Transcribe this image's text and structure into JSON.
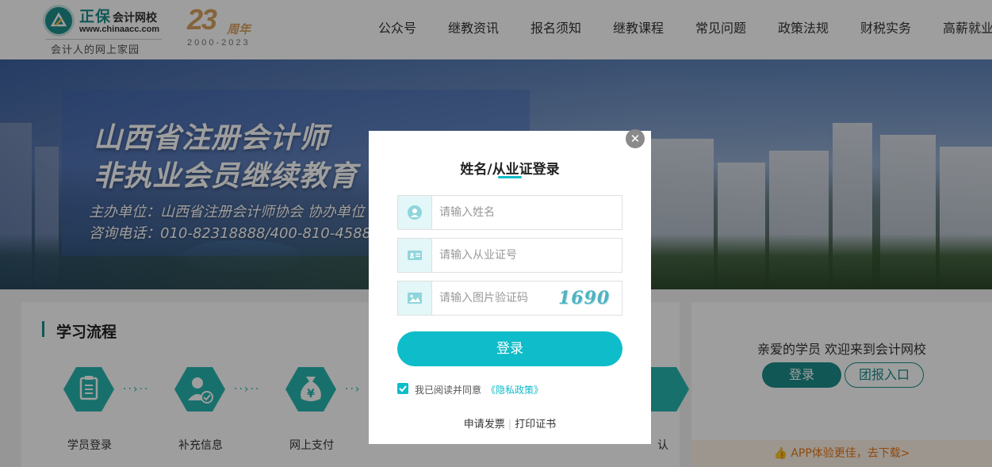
{
  "header": {
    "logo_brand": "正保",
    "logo_brand_sub": "会计网校",
    "logo_url": "www.chinaacc.com",
    "logo_slogan": "会计人的网上家园",
    "anniversary_number": "23",
    "anniversary_suffix": "周年",
    "anniversary_years": "2000-2023",
    "nav": [
      "公众号",
      "继教资讯",
      "报名须知",
      "继教课程",
      "常见问题",
      "政策法规",
      "财税实务",
      "高薪就业"
    ]
  },
  "banner": {
    "title_line1": "山西省注册会计师",
    "title_line2": "非执业会员继续教育",
    "organizer": "主办单位：山西省注册会计师协会   协办单位",
    "phone": "咨询电话：010-82318888/400-810-4588"
  },
  "study_process": {
    "title": "学习流程",
    "steps": [
      {
        "label": "学员登录",
        "icon": "clipboard-icon"
      },
      {
        "label": "补充信息",
        "icon": "user-check-icon"
      },
      {
        "label": "网上支付",
        "icon": "money-bag-icon"
      }
    ],
    "partial_label": "认"
  },
  "side_panel": {
    "welcome": "亲爱的学员 欢迎来到会计网校",
    "login_label": "登录",
    "group_label": "团报入口",
    "app_promo": "APP体验更佳，去下载>"
  },
  "modal": {
    "title": "姓名/从业证登录",
    "name_placeholder": "请输入姓名",
    "cert_placeholder": "请输入从业证号",
    "captcha_placeholder": "请输入图片验证码",
    "captcha_text": "1690",
    "login_label": "登录",
    "agree_text": "我已阅读并同意",
    "privacy_link": "《隐私政策》",
    "invoice_link": "申请发票",
    "certificate_link": "打印证书",
    "close_symbol": "✕"
  },
  "colors": {
    "brand": "#1a8d8a",
    "accent": "#0fbcc9",
    "gold": "#d7a261",
    "promo": "#e67817"
  }
}
